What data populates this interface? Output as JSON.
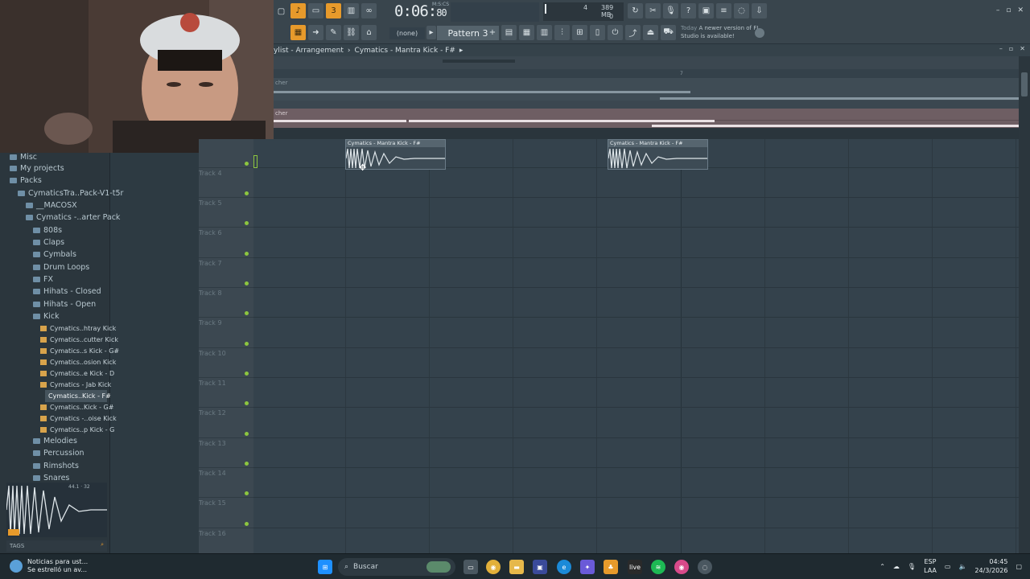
{
  "app": {
    "time_display": "0:06:",
    "time_frames": "80",
    "time_unit": "M:S:CS",
    "cpu_value": "4",
    "memory": "389 MB",
    "cpu_zero": "0",
    "pattern_none": "(none)",
    "pattern_selected": "Pattern 3",
    "hint_today": "Today",
    "hint_text": "A newer version of FL Studio is available!"
  },
  "playlist": {
    "breadcrumb": [
      "ylist - Arrangement",
      "Cymatics - Mantra Kick - F#"
    ],
    "ruler_mark": "7",
    "lane1_label": "cher",
    "lane2_label": "cher"
  },
  "browser": {
    "items": [
      {
        "label": "Misc",
        "type": "folder"
      },
      {
        "label": "My projects",
        "type": "folder"
      },
      {
        "label": "Packs",
        "type": "folder"
      },
      {
        "label": "CymaticsTra..Pack-V1-t5r",
        "type": "folder"
      },
      {
        "label": "__MACOSX",
        "type": "folder"
      },
      {
        "label": "Cymatics -..arter Pack",
        "type": "folder"
      },
      {
        "label": "808s",
        "type": "folder"
      },
      {
        "label": "Claps",
        "type": "folder"
      },
      {
        "label": "Cymbals",
        "type": "folder"
      },
      {
        "label": "Drum Loops",
        "type": "folder"
      },
      {
        "label": "FX",
        "type": "folder"
      },
      {
        "label": "Hihats - Closed",
        "type": "folder"
      },
      {
        "label": "Hihats - Open",
        "type": "folder"
      },
      {
        "label": "Kick",
        "type": "folder"
      },
      {
        "label": "Cymatics..htray Kick",
        "type": "file"
      },
      {
        "label": "Cymatics..cutter Kick",
        "type": "file"
      },
      {
        "label": "Cymatics..s Kick - G#",
        "type": "file"
      },
      {
        "label": "Cymatics..osion Kick",
        "type": "file"
      },
      {
        "label": "Cymatics..e Kick - D",
        "type": "file"
      },
      {
        "label": "Cymatics - Jab Kick",
        "type": "file"
      },
      {
        "label": "Cymatics..Kick - F#",
        "type": "file"
      },
      {
        "label": "Cymatics..Kick - G#",
        "type": "file"
      },
      {
        "label": "Cymatics -..oise Kick",
        "type": "file"
      },
      {
        "label": "Cymatics..p Kick - G",
        "type": "file"
      },
      {
        "label": "Melodies",
        "type": "folder"
      },
      {
        "label": "Percussion",
        "type": "folder"
      },
      {
        "label": "Rimshots",
        "type": "folder"
      },
      {
        "label": "Snares",
        "type": "folder"
      }
    ],
    "preview_info": "44.1",
    "preview_bits": "32",
    "tags_label": "TAGS"
  },
  "tracks": [
    "Track 4",
    "Track 5",
    "Track 6",
    "Track 7",
    "Track 8",
    "Track 9",
    "Track 10",
    "Track 11",
    "Track 12",
    "Track 13",
    "Track 14",
    "Track 15",
    "Track 16"
  ],
  "clips": [
    {
      "label": "Cymatics - Mantra Kick - F#"
    },
    {
      "label": "Cymatics - Mantra Kick - F#"
    }
  ],
  "taskbar": {
    "news_title": "Noticias para ust...",
    "news_sub": "Se estrelló un av...",
    "search_label": "Buscar",
    "lang_top": "ESP",
    "lang_bottom": "LAA",
    "time": "04:45",
    "date": "24/3/2026"
  }
}
